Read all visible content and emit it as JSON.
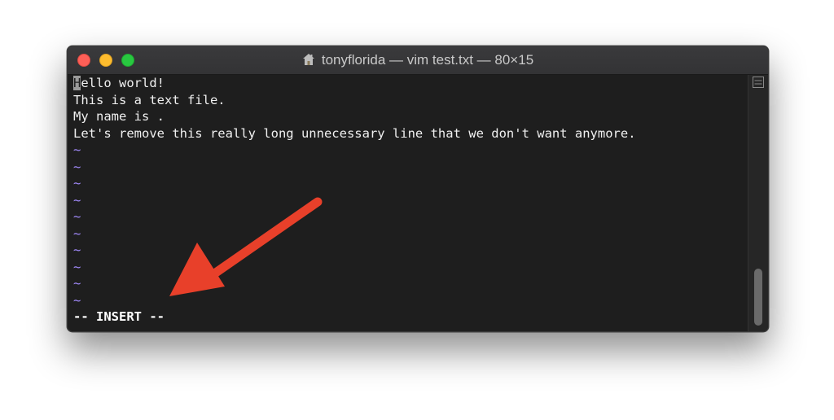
{
  "window": {
    "title": "tonyflorida — vim test.txt — 80×15"
  },
  "editor": {
    "cursor_char": "H",
    "first_line_rest": "ello world!",
    "lines": [
      "This is a text file.",
      "My name is .",
      "Let's remove this really long unnecessary line that we don't want anymore."
    ],
    "tilde": "~",
    "mode": "-- INSERT --"
  },
  "colors": {
    "tilde": "#a48cff",
    "arrow": "#e8402a",
    "background": "#1e1e1e"
  },
  "icons": {
    "title": "home-icon",
    "scroll_corner": "split-pane-icon",
    "annotation": "arrow-icon"
  }
}
